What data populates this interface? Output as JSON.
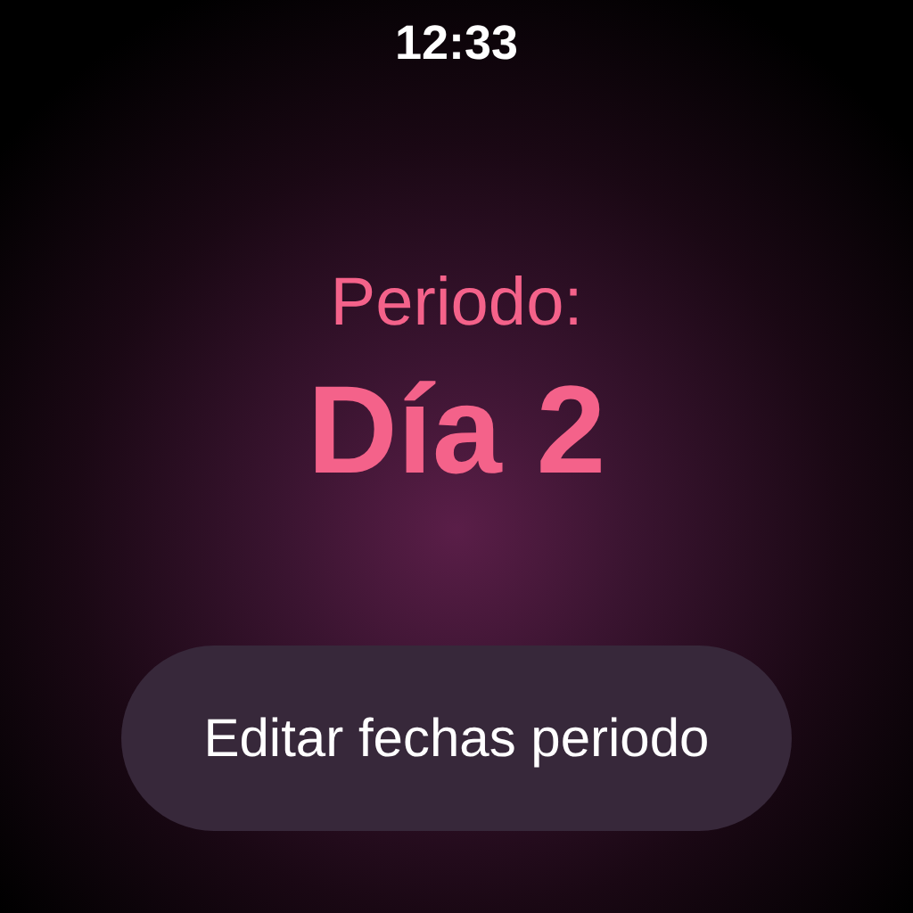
{
  "status_bar": {
    "time": "12:33"
  },
  "period": {
    "label": "Periodo:",
    "value": "Día 2"
  },
  "buttons": [
    {
      "label": "Editar fechas periodo"
    }
  ]
}
